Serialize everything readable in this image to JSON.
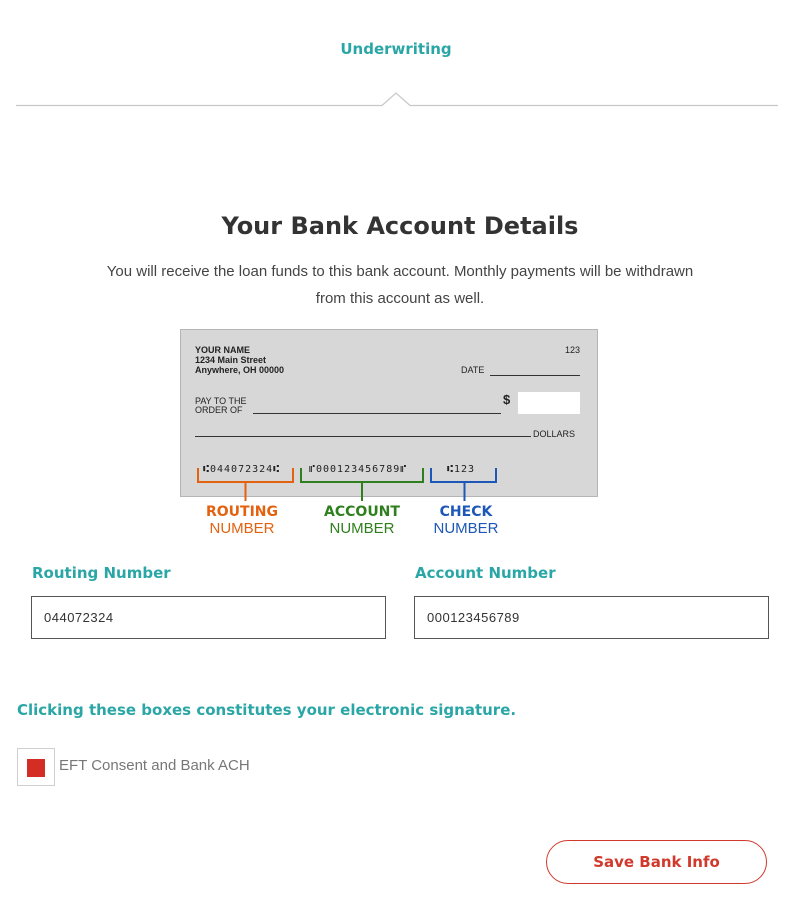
{
  "header": {
    "step_label": "Underwriting"
  },
  "main": {
    "title": "Your Bank Account Details",
    "subtitle_line1": "You will receive the loan funds to this bank account. Monthly payments will be withdrawn",
    "subtitle_line2": "from this account as well."
  },
  "check_image": {
    "name": "YOUR NAME",
    "street": "1234 Main Street",
    "city": "Anywhere, OH 00000",
    "check_no": "123",
    "date_label": "DATE",
    "pay_to_1": "PAY TO THE",
    "pay_to_2": "ORDER OF",
    "dollar_sign": "$",
    "dollars_label": "DOLLARS",
    "micr_routing": "⑆044072324⑆",
    "micr_account": "⑈000123456789⑈",
    "micr_check": "⑆123",
    "labels": {
      "routing_1": "ROUTING",
      "routing_2": "NUMBER",
      "account_1": "ACCOUNT",
      "account_2": "NUMBER",
      "check_1": "CHECK",
      "check_2": "NUMBER"
    },
    "colors": {
      "routing": "#e3620f",
      "account": "#2f7f1e",
      "check": "#1d57b8"
    }
  },
  "form": {
    "routing_label": "Routing Number",
    "routing_value": "044072324",
    "account_label": "Account Number",
    "account_value": "000123456789"
  },
  "signature_note": "Clicking these boxes constitutes your electronic signature.",
  "consent": {
    "label": "EFT Consent and Bank ACH",
    "checked": true
  },
  "actions": {
    "save_label": "Save Bank Info"
  },
  "theme": {
    "accent": "#2aa6a6",
    "danger": "#d0392b"
  }
}
